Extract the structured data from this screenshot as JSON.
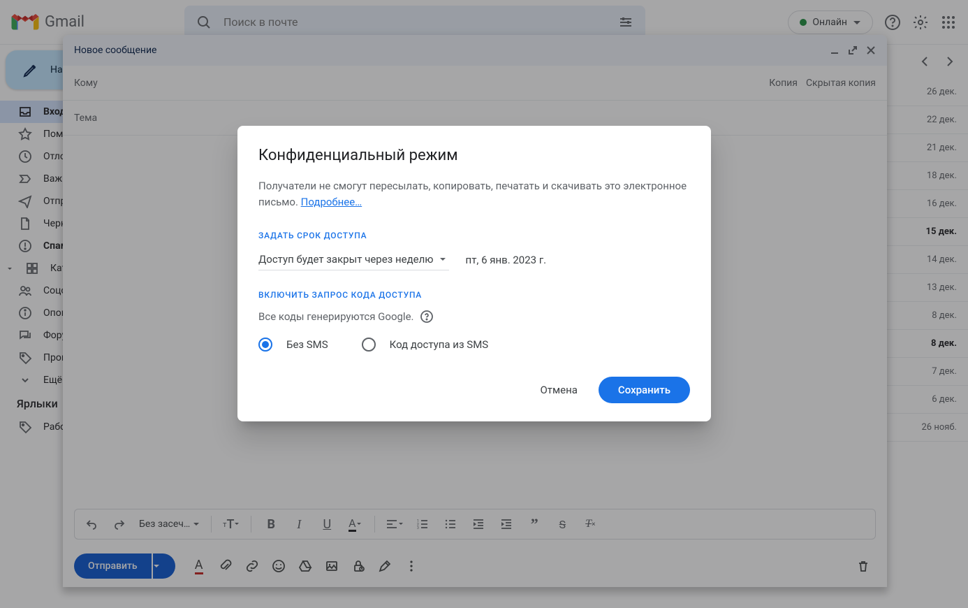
{
  "header": {
    "logo_text": "Gmail",
    "search_placeholder": "Поиск в почте",
    "status_label": "Онлайн"
  },
  "sidebar": {
    "compose_label": "Написать",
    "items": [
      {
        "label": "Входящие"
      },
      {
        "label": "Помеченные"
      },
      {
        "label": "Отложенные"
      },
      {
        "label": "Важные"
      },
      {
        "label": "Отправленные"
      },
      {
        "label": "Черновики"
      },
      {
        "label": "Спам"
      },
      {
        "label": "Категории"
      },
      {
        "label": "Соцсети"
      },
      {
        "label": "Оповещения"
      },
      {
        "label": "Форумы"
      },
      {
        "label": "Промоакции"
      },
      {
        "label": "Ещё"
      }
    ],
    "labels_header": "Ярлыки",
    "labels": [
      {
        "label": "Работа"
      }
    ]
  },
  "mail_dates": [
    {
      "d": "26 дек.",
      "unread": false
    },
    {
      "d": "22 дек.",
      "unread": false
    },
    {
      "d": "21 дек.",
      "unread": false
    },
    {
      "d": "18 дек.",
      "unread": false
    },
    {
      "d": "16 дек.",
      "unread": false
    },
    {
      "d": "15 дек.",
      "unread": true
    },
    {
      "d": "14 дек.",
      "unread": false
    },
    {
      "d": "13 дек.",
      "unread": false
    },
    {
      "d": "8 дек.",
      "unread": false
    },
    {
      "d": "8 дек.",
      "unread": true
    },
    {
      "d": "7 дек.",
      "unread": false
    },
    {
      "d": "6 дек.",
      "unread": false
    },
    {
      "d": "26 нояб.",
      "unread": false
    }
  ],
  "compose": {
    "title": "Новое сообщение",
    "to_label": "Кому",
    "cc_label": "Копия",
    "bcc_label": "Скрытая копия",
    "subject_label": "Тема",
    "font_label": "Без засеч…",
    "send_label": "Отправить"
  },
  "modal": {
    "title": "Конфиденциальный режим",
    "desc": "Получатели не смогут пересылать, копировать, печатать и скачивать это электронное письмо. ",
    "learn_more": "Подробнее…",
    "expiry_header": "ЗАДАТЬ СРОК ДОСТУПА",
    "expiry_select": "Доступ будет закрыт через неделю",
    "expiry_date": "пт, 6 янв. 2023 г.",
    "passcode_header": "ВКЛЮЧИТЬ ЗАПРОС КОДА ДОСТУПА",
    "passcode_note": "Все коды генерируются Google.",
    "radio_no_sms": "Без SMS",
    "radio_sms": "Код доступа из SMS",
    "cancel": "Отмена",
    "save": "Сохранить"
  }
}
